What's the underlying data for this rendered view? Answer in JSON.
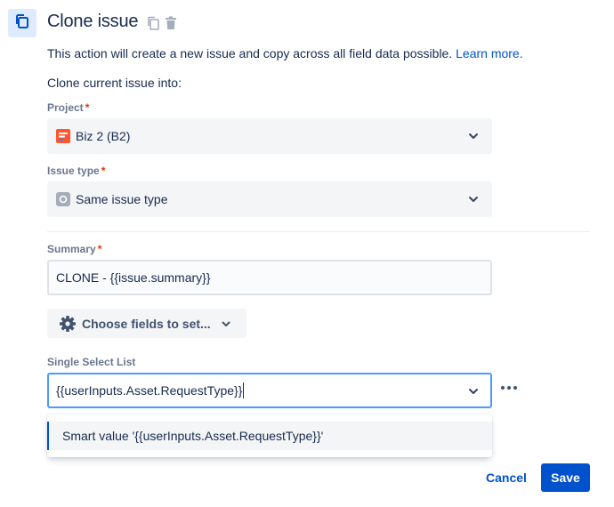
{
  "header": {
    "title": "Clone issue",
    "icon": "clone-icon",
    "actions": [
      "copy-icon",
      "trash-icon"
    ]
  },
  "description": {
    "text": "This action will create a new issue and copy across all field data possible.",
    "link": "Learn more."
  },
  "clone_into_label": "Clone current issue into:",
  "project": {
    "label": "Project",
    "required_mark": "*",
    "value": "Biz 2 (B2)",
    "icon": "project-icon"
  },
  "issue_type": {
    "label": "Issue type",
    "required_mark": "*",
    "value": "Same issue type",
    "icon": "issue-type-icon"
  },
  "summary": {
    "label": "Summary",
    "required_mark": "*",
    "value": "CLONE - {{issue.summary}}"
  },
  "choose_fields": {
    "label": "Choose fields to set..."
  },
  "single_select": {
    "label": "Single Select List",
    "value": "{{userInputs.Asset.RequestType}}",
    "options": [
      "Smart value '{{userInputs.Asset.RequestType}}'"
    ]
  },
  "footer": {
    "cancel": "Cancel",
    "save": "Save"
  },
  "colors": {
    "accent": "#0052cc",
    "required": "#de350b",
    "focus": "#4c9aff"
  }
}
